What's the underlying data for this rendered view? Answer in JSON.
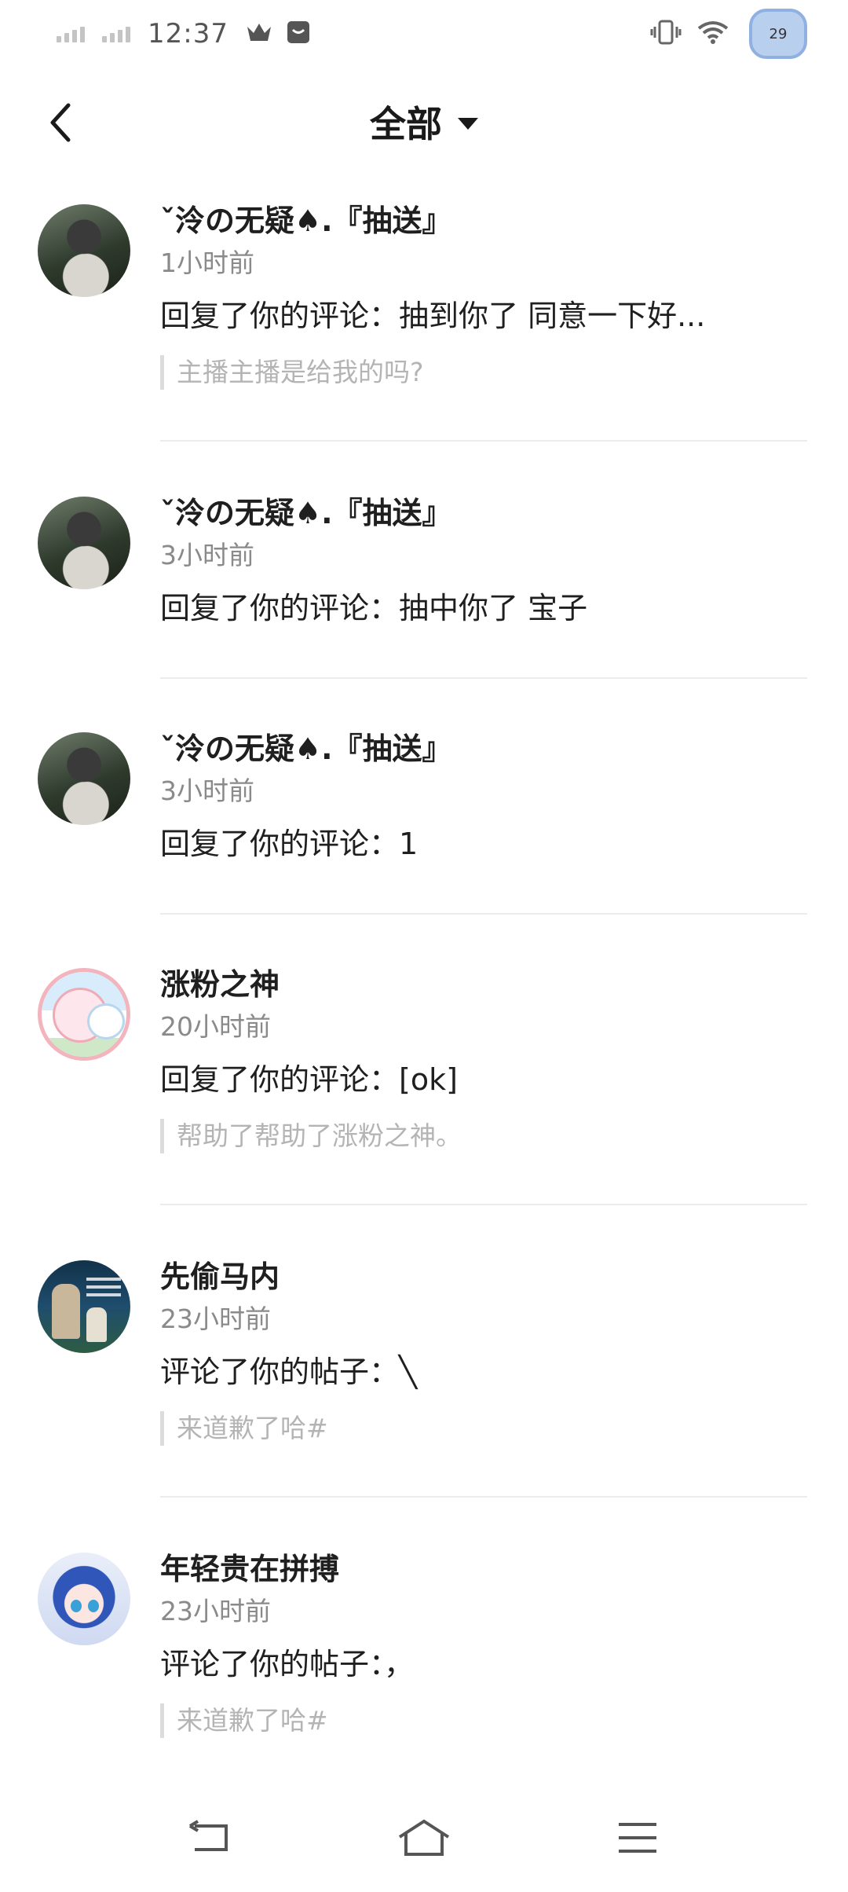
{
  "status_bar": {
    "time": "12:37",
    "battery_level": "29"
  },
  "header": {
    "title": "全部"
  },
  "notifications": [
    {
      "name": "ˇ泠の无疑♠.『抽送』",
      "time": "1小时前",
      "message": "回复了你的评论：抽到你了 同意一下好...",
      "quote": "主播主播是给我的吗?",
      "avatar": "avatar-girl"
    },
    {
      "name": "ˇ泠の无疑♠.『抽送』",
      "time": "3小时前",
      "message": "回复了你的评论：抽中你了 宝子",
      "quote": "",
      "avatar": "avatar-girl"
    },
    {
      "name": "ˇ泠の无疑♠.『抽送』",
      "time": "3小时前",
      "message": "回复了你的评论：1",
      "quote": "",
      "avatar": "avatar-girl"
    },
    {
      "name": "涨粉之神",
      "time": "20小时前",
      "message": "回复了你的评论：[ok]",
      "quote": "帮助了帮助了涨粉之神。",
      "avatar": "avatar-cat"
    },
    {
      "name": "先偷马内",
      "time": "23小时前",
      "message": "评论了你的帖子：╲",
      "quote": "来道歉了哈#",
      "avatar": "avatar-poster"
    },
    {
      "name": "年轻贵在拼搏",
      "time": "23小时前",
      "message": "评论了你的帖子：，",
      "quote": "来道歉了哈#",
      "avatar": "avatar-anime"
    }
  ],
  "colors": {
    "text_primary": "#1f1f1f",
    "text_secondary": "#8a8a8a",
    "quote_text": "#b4b4b4",
    "divider": "#ececec"
  }
}
